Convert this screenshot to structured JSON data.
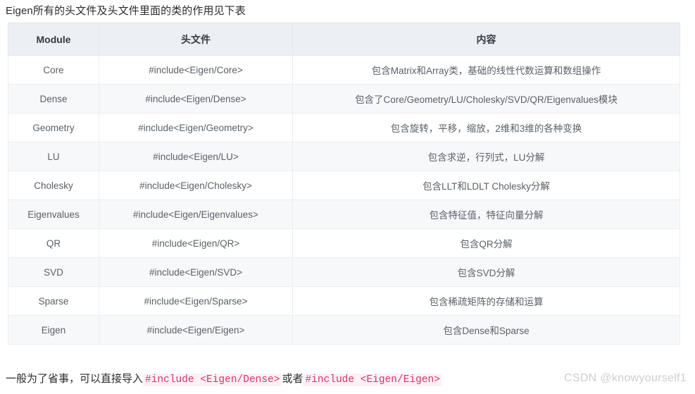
{
  "intro": {
    "text": "Eigen所有的头文件及头文件里面的类的作用见下表"
  },
  "table": {
    "headers": [
      "Module",
      "头文件",
      "内容"
    ],
    "rows": [
      {
        "module": "Core",
        "header_file": "#include<Eigen/Core>",
        "content": "包含Matrix和Array类，基础的线性代数运算和数组操作"
      },
      {
        "module": "Dense",
        "header_file": "#include<Eigen/Dense>",
        "content": "包含了Core/Geometry/LU/Cholesky/SVD/QR/Eigenvalues模块"
      },
      {
        "module": "Geometry",
        "header_file": "#include<Eigen/Geometry>",
        "content": "包含旋转，平移，缩放，2维和3维的各种变换"
      },
      {
        "module": "LU",
        "header_file": "#include<Eigen/LU>",
        "content": "包含求逆，行列式，LU分解"
      },
      {
        "module": "Cholesky",
        "header_file": "#include<Eigen/Cholesky>",
        "content": "包含LLT和LDLT Cholesky分解"
      },
      {
        "module": "Eigenvalues",
        "header_file": "#include<Eigen/Eigenvalues>",
        "content": "包含特征值，特征向量分解"
      },
      {
        "module": "QR",
        "header_file": "#include<Eigen/QR>",
        "content": "包含QR分解"
      },
      {
        "module": "SVD",
        "header_file": "#include<Eigen/SVD>",
        "content": "包含SVD分解"
      },
      {
        "module": "Sparse",
        "header_file": "#include<Eigen/Sparse>",
        "content": "包含稀疏矩阵的存储和运算"
      },
      {
        "module": "Eigen",
        "header_file": "#include<Eigen/Eigen>",
        "content": "包含Dense和Sparse"
      }
    ]
  },
  "footer": {
    "lead": "一般为了省事，可以直接导入",
    "code_1": "#include <Eigen/Dense>",
    "middle": "或者",
    "code_2": "#include <Eigen/Eigen>"
  },
  "watermark": {
    "text": "CSDN @knowyourself1"
  },
  "colors": {
    "header_background": "#eceff3",
    "row_stripe": "#f7f8f9",
    "row_plain": "#ffffff",
    "border": "#e3e6ea",
    "body_text": "#5a6169",
    "header_text": "#333a42",
    "code_text": "#d6336c",
    "code_background": "#fdf1f4",
    "watermark_text": "#cfcfcf"
  }
}
